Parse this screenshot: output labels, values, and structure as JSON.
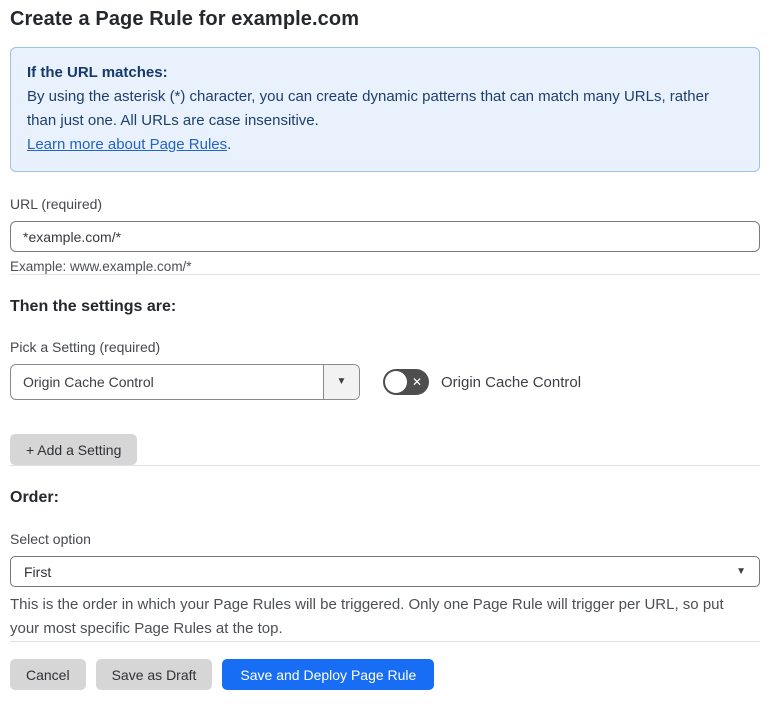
{
  "page": {
    "title": "Create a Page Rule for example.com"
  },
  "info_box": {
    "heading": "If the URL matches:",
    "body": "By using the asterisk (*) character, you can create dynamic patterns that can match many URLs, rather than just one. All URLs are case insensitive.",
    "link": "Learn more about Page Rules",
    "link_suffix": "."
  },
  "url_field": {
    "label": "URL (required)",
    "value": "*example.com/*",
    "helper": "Example: www.example.com/*"
  },
  "settings": {
    "heading": "Then the settings are:",
    "pick_label": "Pick a Setting (required)",
    "selected_setting": "Origin Cache Control",
    "caret": "▼",
    "toggle_state": "off",
    "toggle_off_glyph": "✕",
    "toggle_label": "Origin Cache Control",
    "add_button": "+ Add a Setting"
  },
  "order": {
    "heading": "Order:",
    "label": "Select option",
    "selected_option": "First",
    "caret": "▼",
    "helper": "This is the order in which your Page Rules will be triggered. Only one Page Rule will trigger per URL, so put your most specific Page Rules at the top."
  },
  "footer": {
    "cancel": "Cancel",
    "save_draft": "Save as Draft",
    "save_deploy": "Save and Deploy Page Rule"
  },
  "colors": {
    "info_bg": "#e9f2fc",
    "info_border": "#9cc2e8",
    "info_text": "#1c3f6e",
    "link": "#2263c3",
    "primary_button": "#186df5",
    "gray_button": "#d6d6d6",
    "toggle_off": "#4e4e4e"
  }
}
